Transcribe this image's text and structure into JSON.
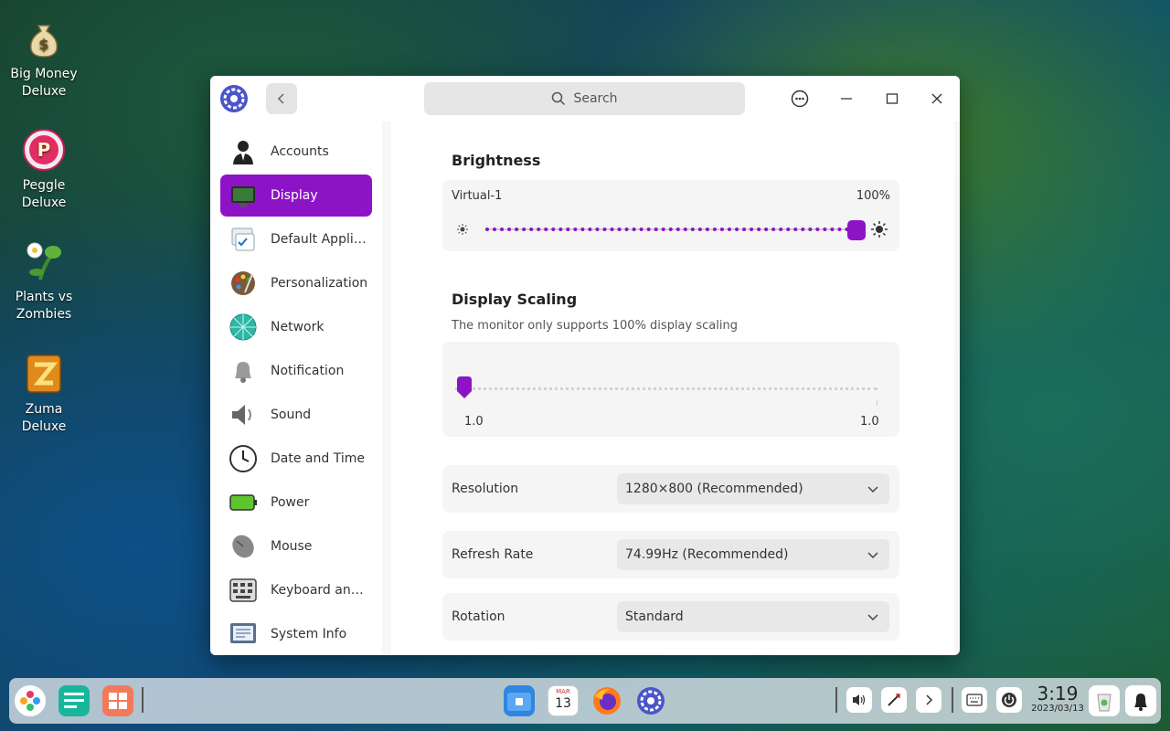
{
  "desktop": {
    "icons": [
      {
        "label": "Big Money\nDeluxe",
        "icon": "money-bag-icon"
      },
      {
        "label": "Peggle\nDeluxe",
        "icon": "peggle-icon"
      },
      {
        "label": "Plants vs\nZombies",
        "icon": "plants-icon"
      },
      {
        "label": "Zuma\nDeluxe",
        "icon": "zuma-icon"
      }
    ]
  },
  "window": {
    "search_placeholder": "Search",
    "sidebar": {
      "items": [
        {
          "label": "Accounts",
          "icon": "accounts-icon"
        },
        {
          "label": "Display",
          "icon": "display-icon",
          "active": true
        },
        {
          "label": "Default Applic...",
          "icon": "default-apps-icon"
        },
        {
          "label": "Personalization",
          "icon": "personalization-icon"
        },
        {
          "label": "Network",
          "icon": "network-icon"
        },
        {
          "label": "Notification",
          "icon": "bell-icon"
        },
        {
          "label": "Sound",
          "icon": "speaker-icon"
        },
        {
          "label": "Date and Time",
          "icon": "clock-icon"
        },
        {
          "label": "Power",
          "icon": "battery-icon"
        },
        {
          "label": "Mouse",
          "icon": "mouse-icon"
        },
        {
          "label": "Keyboard and ...",
          "icon": "keyboard-icon"
        },
        {
          "label": "System Info",
          "icon": "system-info-icon"
        }
      ]
    },
    "brightness": {
      "title": "Brightness",
      "monitor": "Virtual-1",
      "value_text": "100%",
      "value": 1.0
    },
    "scaling": {
      "title": "Display Scaling",
      "note": "The monitor only supports 100% display scaling",
      "min_label": "1.0",
      "max_label": "1.0",
      "value": 0
    },
    "resolution": {
      "label": "Resolution",
      "value": "1280×800 (Recommended)"
    },
    "refresh_rate": {
      "label": "Refresh Rate",
      "value": "74.99Hz (Recommended)"
    },
    "rotation": {
      "label": "Rotation",
      "value": "Standard"
    }
  },
  "taskbar": {
    "calendar_day": "13",
    "calendar_month": "MAR",
    "clock_time": "3:19",
    "clock_date": "2023/03/13"
  },
  "colors": {
    "accent": "#8c14c6"
  }
}
